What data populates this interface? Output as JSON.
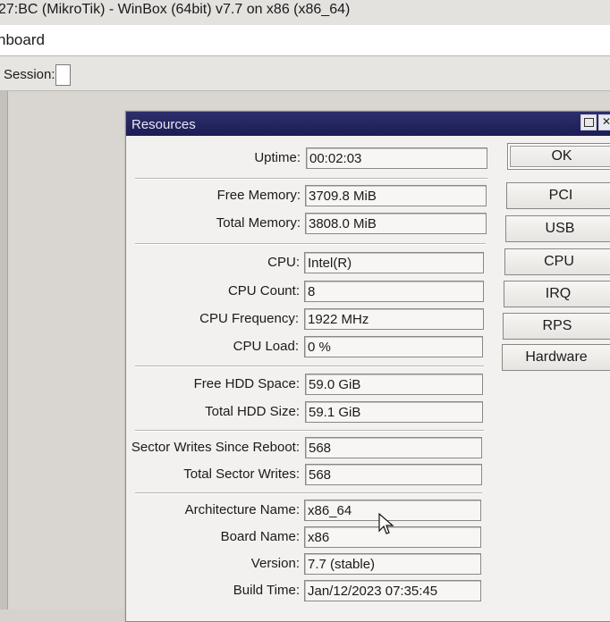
{
  "window": {
    "title": "27:BC (MikroTik) - WinBox (64bit) v7.7 on x86 (x86_64)"
  },
  "menubar": {
    "label": "hboard"
  },
  "toolbar": {
    "session_label": "Session:",
    "session_value": ""
  },
  "dialog": {
    "title": "Resources",
    "fields": {
      "uptime": {
        "label": "Uptime:",
        "value": "00:02:03"
      },
      "free_memory": {
        "label": "Free Memory:",
        "value": "3709.8 MiB"
      },
      "total_memory": {
        "label": "Total Memory:",
        "value": "3808.0 MiB"
      },
      "cpu": {
        "label": "CPU:",
        "value": "Intel(R)"
      },
      "cpu_count": {
        "label": "CPU Count:",
        "value": "8"
      },
      "cpu_frequency": {
        "label": "CPU Frequency:",
        "value": "1922 MHz"
      },
      "cpu_load": {
        "label": "CPU Load:",
        "value": "0 %"
      },
      "free_hdd": {
        "label": "Free HDD Space:",
        "value": "59.0 GiB"
      },
      "total_hdd": {
        "label": "Total HDD Size:",
        "value": "59.1 GiB"
      },
      "sector_writes_reboot": {
        "label": "Sector Writes Since Reboot:",
        "value": "568"
      },
      "total_sector_writes": {
        "label": "Total Sector Writes:",
        "value": "568"
      },
      "architecture": {
        "label": "Architecture Name:",
        "value": "x86_64"
      },
      "board_name": {
        "label": "Board Name:",
        "value": "x86"
      },
      "version": {
        "label": "Version:",
        "value": "7.7 (stable)"
      },
      "build_time": {
        "label": "Build Time:",
        "value": "Jan/12/2023 07:35:45"
      }
    },
    "buttons": {
      "ok": "OK",
      "pci": "PCI",
      "usb": "USB",
      "cpu": "CPU",
      "irq": "IRQ",
      "rps": "RPS",
      "hardware": "Hardware"
    }
  }
}
